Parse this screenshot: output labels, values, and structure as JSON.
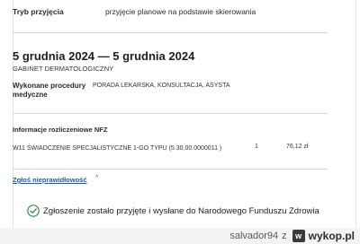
{
  "admission": {
    "label": "Tryb przyjęcia",
    "value": "przyjęcie planowe na podstawie skierowania"
  },
  "visit": {
    "date_range": "5 grudnia 2024 — 5 grudnia 2024",
    "clinic": "GABINET DERMATOLOGICZNY",
    "procedures_label": "Wykonane procedury medyczne",
    "procedures_value": "PORADA LEKARSKA, KONSULTACJA, ASYSTA"
  },
  "nfz": {
    "title": "Informacje rozliczeniowe NFZ",
    "service": "W11 ŚWIADCZENIE SPECJALISTYCZNE 1-GO TYPU (5.30.00.0000011 )",
    "quantity": "1",
    "price": "76,12 zł"
  },
  "report_link": "Zgłoś nieprawidłowość",
  "success_message": "Zgłoszenie zostało przyjęte i wysłane do Narodowego Funduszu Zdrowia",
  "watermark": {
    "user": "salvador94",
    "sep": "z",
    "logo": "wykop.pl"
  },
  "colors": {
    "link": "#1f5fa8",
    "success": "#2e8b3e"
  }
}
